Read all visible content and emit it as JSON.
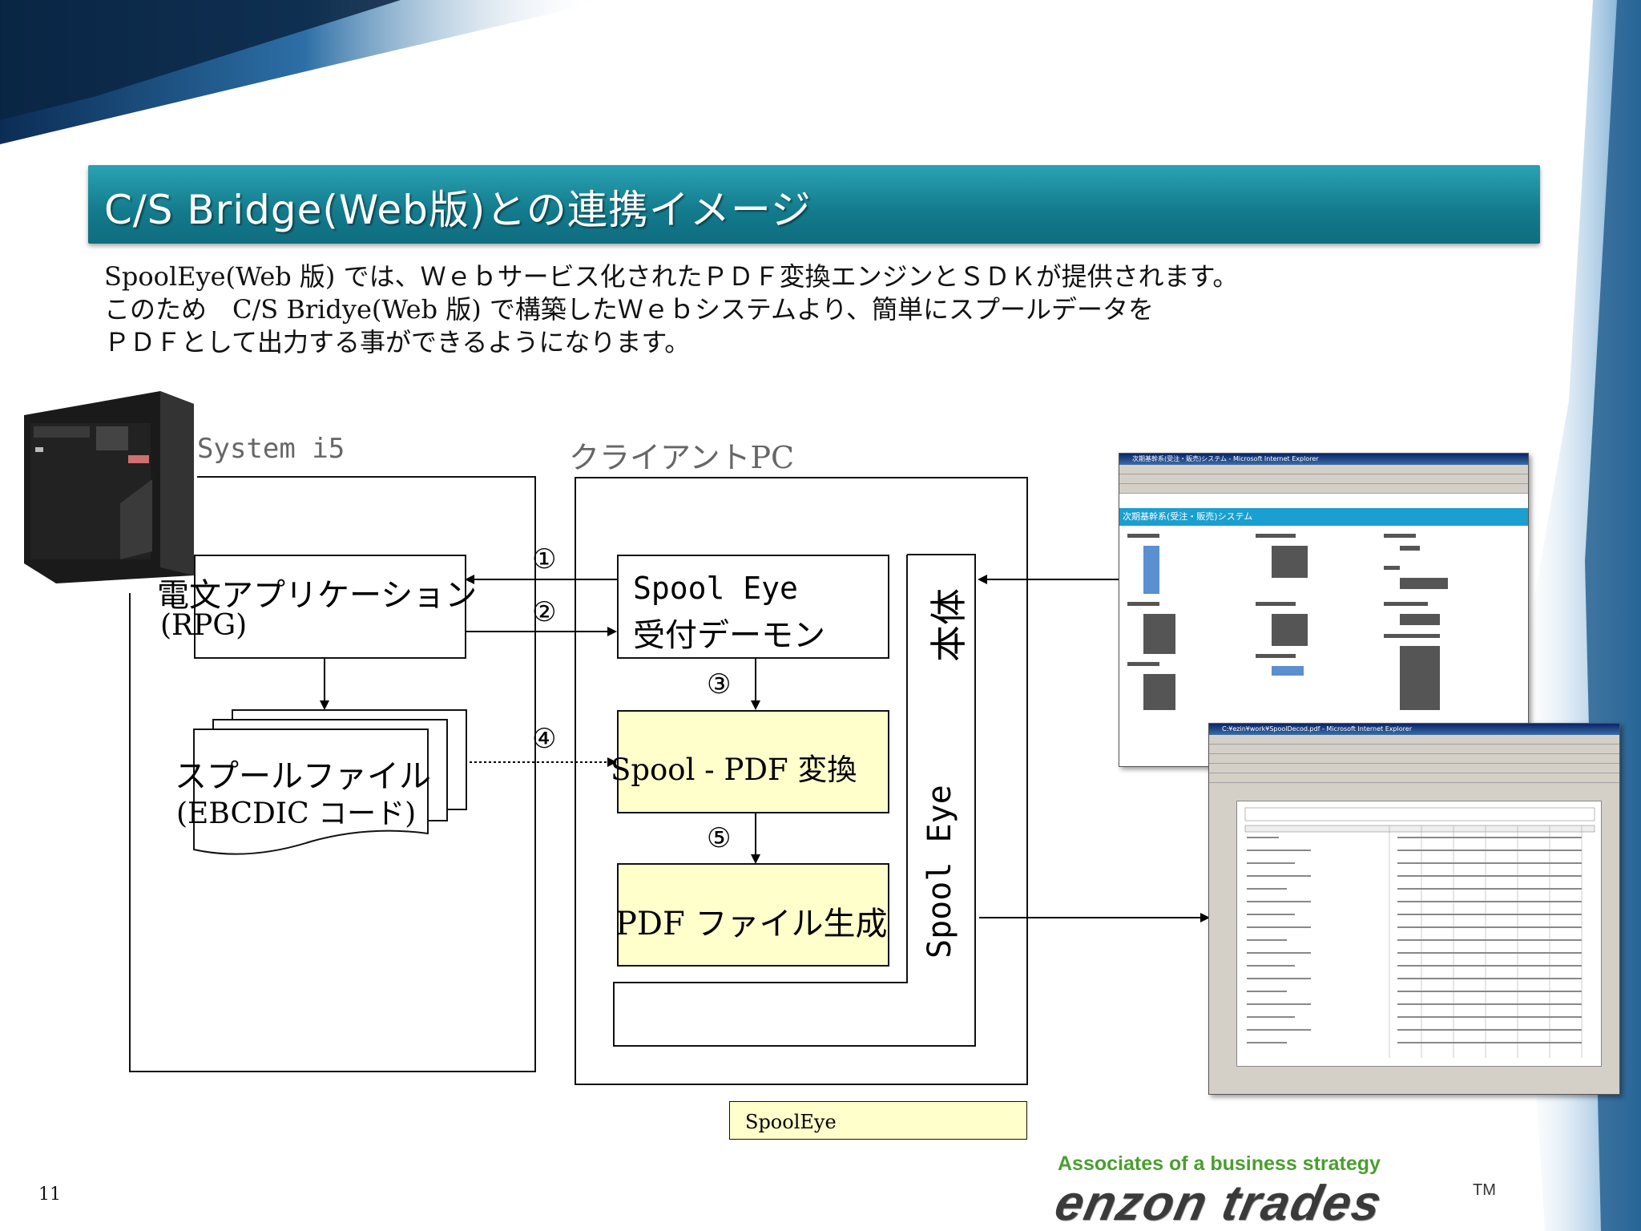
{
  "slide": {
    "title": "C/S Bridge(Web版)との連携イメージ",
    "intro_lines": [
      "SpoolEye(Web 版) では、Ｗｅｂサービス化されたＰＤＦ変換エンジンとＳＤＫが提供されます。",
      "このため　C/S Bridye(Web 版) で構築したＷｅｂシステムより、簡単にスプールデータを",
      "ＰＤＦとして出力する事ができるようになります。"
    ],
    "page_number": "11"
  },
  "diagram": {
    "system_label": "System i5",
    "client_label": "クライアントPC",
    "app_box": [
      "電文アプリケーション",
      "(RPG)"
    ],
    "spool_file": [
      "スプールファイル",
      "(EBCDIC コード)"
    ],
    "daemon_box": [
      "Spool Eye",
      "受付デーモン"
    ],
    "pdf_convert": "Spool - PDF 変換",
    "pdf_generate": "PDF ファイル生成",
    "spooleye_main": "Spool Eye",
    "spooleye_main_suffix": "本体",
    "steps": [
      "①",
      "②",
      "③",
      "④",
      "⑤"
    ],
    "legend": "SpoolEye"
  },
  "screenshots": {
    "web_app_title": "次期基幹系(受注・販売)システム - Microsoft Internet Explorer",
    "web_app_heading": "次期基幹系(受注・販売)システム",
    "pdf_viewer_title": "C:¥ezin¥work¥SpoolDecod.pdf - Microsoft Internet Explorer"
  },
  "brand": {
    "tagline": "Associates of a business strategy",
    "logo": "enzon trades",
    "tm": "TM"
  },
  "colors": {
    "title_bar": "#127a8c",
    "box_fill": "#ffffcc",
    "brand_green": "#4a9e2e"
  }
}
